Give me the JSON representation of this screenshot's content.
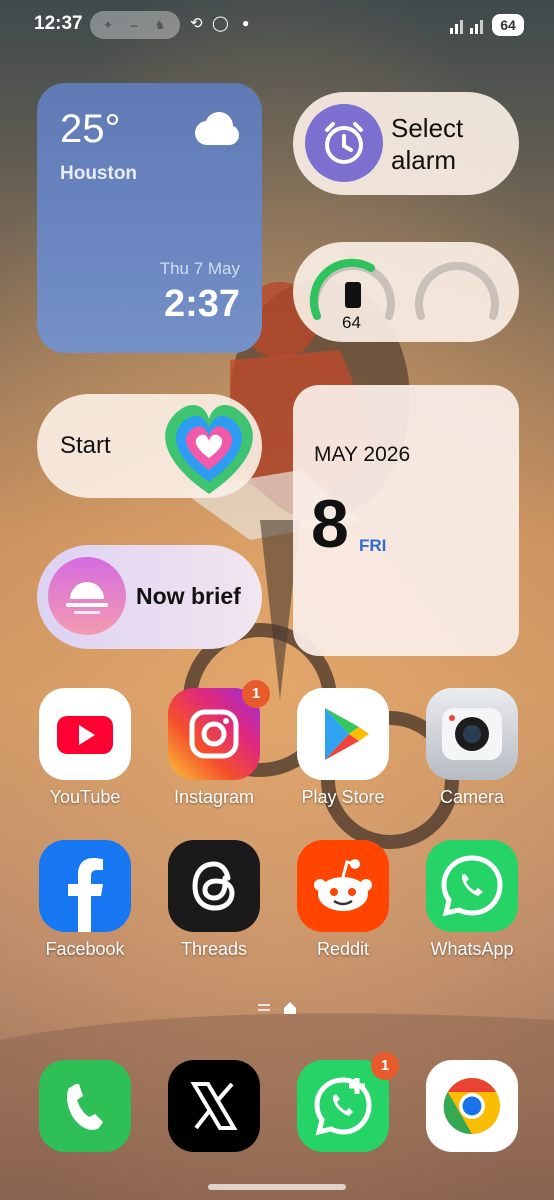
{
  "status_bar": {
    "time": "12:37",
    "battery": "64"
  },
  "weather_widget": {
    "temperature": "25°",
    "city": "Houston",
    "date": "Thu 7 May",
    "time": "2:37"
  },
  "alarm_widget": {
    "label": "Select alarm"
  },
  "battery_widget": {
    "device_level": "64"
  },
  "start_widget": {
    "label": "Start"
  },
  "calendar_widget": {
    "month_year": "MAY 2026",
    "day": "8",
    "weekday": "FRI"
  },
  "brief_widget": {
    "label": "Now brief"
  },
  "apps_row1": [
    {
      "label": "YouTube",
      "icon": "youtube-icon"
    },
    {
      "label": "Instagram",
      "icon": "instagram-icon",
      "badge": "1"
    },
    {
      "label": "Play Store",
      "icon": "play-store-icon"
    },
    {
      "label": "Camera",
      "icon": "camera-icon"
    }
  ],
  "apps_row2": [
    {
      "label": "Facebook",
      "icon": "facebook-icon"
    },
    {
      "label": "Threads",
      "icon": "threads-icon"
    },
    {
      "label": "Reddit",
      "icon": "reddit-icon"
    },
    {
      "label": "WhatsApp",
      "icon": "whatsapp-icon"
    }
  ],
  "dock": [
    {
      "icon": "phone-icon"
    },
    {
      "icon": "x-icon"
    },
    {
      "icon": "whatsapp-business-icon",
      "badge": "1"
    },
    {
      "icon": "chrome-icon"
    }
  ],
  "colors": {
    "weather_bg": "#6b86c0",
    "alarm_accent": "#7b6fd0",
    "badge": "#e85a2b",
    "calendar_weekday": "#2d6fd1"
  }
}
